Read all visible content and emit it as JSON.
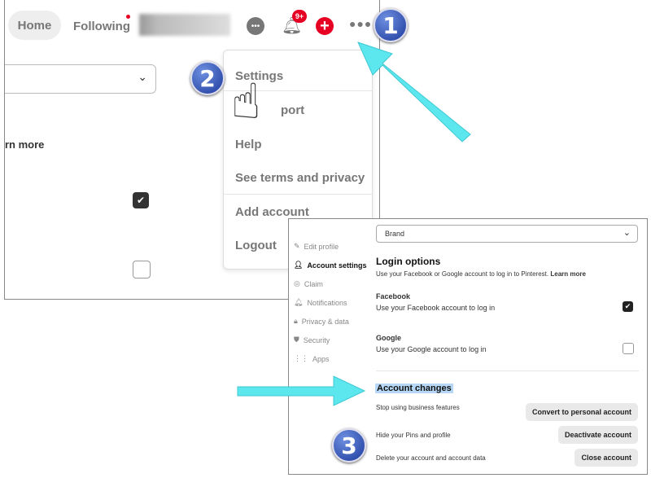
{
  "top": {
    "nav": {
      "home": "Home",
      "following": "Following"
    },
    "notif_badge": "9+",
    "learn_more_partial": "rn more",
    "menu": [
      "Settings",
      "port",
      "Help",
      "See terms and privacy",
      "Add account",
      "Logout"
    ]
  },
  "bottom": {
    "sidebar": [
      "Edit profile",
      "Account settings",
      "Claim",
      "Notifications",
      "Privacy & data",
      "Security",
      "Apps"
    ],
    "account_type": "Brand",
    "login": {
      "title": "Login options",
      "desc": "Use your Facebook or Google account to log in to Pinterest.",
      "learn_more": "Learn more",
      "facebook": {
        "title": "Facebook",
        "desc": "Use your Facebook account to log in",
        "checked": true
      },
      "google": {
        "title": "Google",
        "desc": "Use your Google account to log in",
        "checked": false
      }
    },
    "changes": {
      "title": "Account changes",
      "rows": [
        {
          "label": "Stop using business features",
          "button": "Convert to personal account"
        },
        {
          "label": "Hide your Pins and profile",
          "button": "Deactivate account"
        },
        {
          "label": "Delete your account and account data",
          "button": "Close account"
        }
      ]
    }
  },
  "steps": [
    "1",
    "2",
    "3"
  ],
  "colors": {
    "arrow": "#5ce6ee",
    "pinterest_red": "#e60023",
    "step_badge": "#2a4aad"
  }
}
